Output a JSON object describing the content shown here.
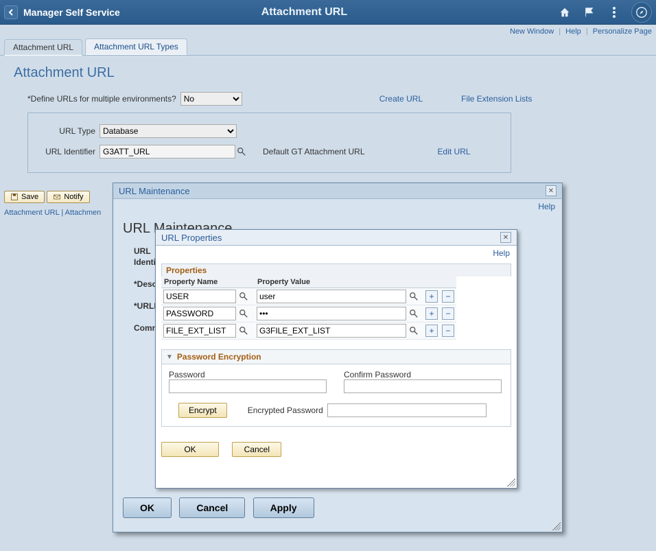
{
  "topbar": {
    "nav_label": "Manager Self Service",
    "page_title": "Attachment URL",
    "icons": {
      "home": "home-icon",
      "flag": "flag-icon",
      "menu": "vertical-dots-icon",
      "nav": "compass-icon"
    }
  },
  "secondary_links": {
    "new_window": "New Window",
    "help": "Help",
    "personalize": "Personalize Page"
  },
  "tabs": [
    {
      "label": "Attachment URL",
      "active": true
    },
    {
      "label": "Attachment URL Types",
      "active": false
    }
  ],
  "page_heading": "Attachment URL",
  "form": {
    "define_multiple_label": "Define URLs for multiple environments?",
    "define_multiple_value": "No",
    "create_url": "Create URL",
    "file_ext_lists": "File Extension Lists",
    "url_type_label": "URL Type",
    "url_type_value": "Database",
    "url_identifier_label": "URL Identifier",
    "url_identifier_value": "G3ATT_URL",
    "default_gt": "Default GT Attachment URL",
    "edit_url": "Edit URL"
  },
  "toolbar": {
    "save": "Save",
    "notify": "Notify"
  },
  "footer_tabs": {
    "t1": "Attachment URL",
    "t2": "Attachmen"
  },
  "outer_modal": {
    "title": "URL Maintenance",
    "help": "Help",
    "heading": "URL Maintenance",
    "labels": {
      "url": "URL",
      "identi": "Identi",
      "descr": "*Descr",
      "urlid": "*URLID",
      "comm": "Comm"
    },
    "buttons": {
      "ok": "OK",
      "cancel": "Cancel",
      "apply": "Apply"
    }
  },
  "inner_modal": {
    "title": "URL Properties",
    "help": "Help",
    "properties_header": "Properties",
    "col_name": "Property Name",
    "col_value": "Property Value",
    "rows": [
      {
        "name": "USER",
        "value": "user"
      },
      {
        "name": "PASSWORD",
        "value": "•••"
      },
      {
        "name": "FILE_EXT_LIST",
        "value": "G3FILE_EXT_LIST"
      }
    ],
    "encryption": {
      "header": "Password Encryption",
      "password_label": "Password",
      "confirm_label": "Confirm Password",
      "encrypt_btn": "Encrypt",
      "encrypted_label": "Encrypted Password"
    },
    "buttons": {
      "ok": "OK",
      "cancel": "Cancel"
    }
  }
}
